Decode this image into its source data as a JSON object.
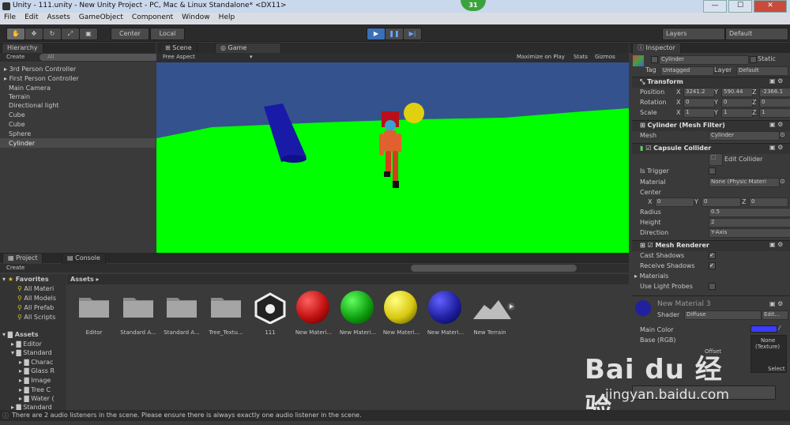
{
  "window": {
    "title": "Unity - 111.unity - New Unity Project - PC, Mac & Linux Standalone* <DX11>",
    "badge": "31",
    "min": "—",
    "max": "☐",
    "close": "✕"
  },
  "menu": [
    "File",
    "Edit",
    "Assets",
    "GameObject",
    "Component",
    "Window",
    "Help"
  ],
  "toolbar": {
    "center": "Center",
    "local": "Local",
    "layers": "Layers",
    "layout": "Default"
  },
  "hierarchy": {
    "tab": "Hierarchy",
    "create": "Create",
    "search_placeholder": "All",
    "items": [
      "3rd Person Controller",
      "First Person Controller",
      "Main Camera",
      "Terrain",
      "Directional light",
      "Cube",
      "Cube",
      "Sphere",
      "Cylinder"
    ]
  },
  "scene_tab": "Scene",
  "game_tab": "Game",
  "game_bar": {
    "aspect": "Free Aspect",
    "maximize": "Maximize on Play",
    "stats": "Stats",
    "gizmos": "Gizmos"
  },
  "inspector": {
    "tab": "Inspector",
    "object_name": "Cylinder",
    "static": "Static",
    "tag_label": "Tag",
    "tag": "Untagged",
    "layer_label": "Layer",
    "layer": "Default",
    "transform": {
      "title": "Transform",
      "pos_label": "Position",
      "rot_label": "Rotation",
      "scale_label": "Scale",
      "pos": [
        "3241.2",
        "590.44",
        "-2366.1"
      ],
      "rot": [
        "0",
        "0",
        "0"
      ],
      "scale": [
        "1",
        "1",
        "1"
      ]
    },
    "mesh_filter": {
      "title": "Cylinder (Mesh Filter)",
      "mesh_label": "Mesh",
      "mesh": "Cylinder"
    },
    "capsule": {
      "title": "Capsule Collider",
      "edit": "Edit Collider",
      "trigger": "Is Trigger",
      "material_label": "Material",
      "material": "None (Physic Materi",
      "center": "Center",
      "center_vals": [
        "0",
        "0",
        "0"
      ],
      "radius_label": "Radius",
      "radius": "0.5",
      "height_label": "Height",
      "height": "2",
      "direction_label": "Direction",
      "direction": "Y-Axis"
    },
    "renderer": {
      "title": "Mesh Renderer",
      "cast": "Cast Shadows",
      "receive": "Receive Shadows",
      "materials": "Materials",
      "probes": "Use Light Probes"
    },
    "material": {
      "name": "New Material 3",
      "shader_label": "Shader",
      "shader": "Diffuse",
      "edit": "Edit...",
      "main_color": "Main Color",
      "base": "Base (RGB)",
      "offset": "Offset",
      "tex_none": "None",
      "tex_type": "(Texture)",
      "select": "Select"
    }
  },
  "project": {
    "tab": "Project",
    "console_tab": "Console",
    "create": "Create",
    "assets_path": "Assets ▸",
    "favorites": "Favorites",
    "fav_items": [
      "All Materi",
      "All Models",
      "All Prefab",
      "All Scripts"
    ],
    "assets_root": "Assets",
    "tree": [
      "Editor",
      "Standard",
      "Charac",
      "Glass R",
      "Image",
      "Tree C",
      "Water (",
      "Standard"
    ],
    "grid": [
      {
        "label": "Editor",
        "kind": "folder"
      },
      {
        "label": "Standard A...",
        "kind": "folder"
      },
      {
        "label": "Standard A...",
        "kind": "folder"
      },
      {
        "label": "Tree_Textu...",
        "kind": "folder"
      },
      {
        "label": "111",
        "kind": "unity"
      },
      {
        "label": "New Materi...",
        "kind": "ball",
        "color": "#c01010"
      },
      {
        "label": "New Materi...",
        "kind": "ball",
        "color": "#10a010"
      },
      {
        "label": "New Materi...",
        "kind": "ball",
        "color": "#d8c810"
      },
      {
        "label": "New Materi...",
        "kind": "ball",
        "color": "#2020a0"
      },
      {
        "label": "New Terrain",
        "kind": "terrain"
      }
    ]
  },
  "status": "There are 2 audio listeners in the scene. Please ensure there is always exactly one audio listener in the scene.",
  "watermark": {
    "logo": "Bai du 经验",
    "url": "jingyan.baidu.com"
  }
}
